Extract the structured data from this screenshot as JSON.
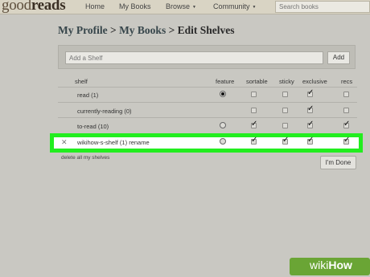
{
  "nav": {
    "logo_light": "good",
    "logo_bold": "reads",
    "home": "Home",
    "my_books": "My Books",
    "browse": "Browse",
    "community": "Community",
    "caret": "▼",
    "search_placeholder": "Search books"
  },
  "breadcrumb": {
    "profile": "My Profile",
    "sep1": ">",
    "books": "My Books",
    "sep2": ">",
    "current": "Edit Shelves"
  },
  "add_shelf": {
    "placeholder": "Add a Shelf",
    "button": "Add"
  },
  "table": {
    "headers": {
      "shelf": "shelf",
      "feature": "feature",
      "sortable": "sortable",
      "sticky": "sticky",
      "exclusive": "exclusive",
      "recs": "recs"
    },
    "rows": [
      {
        "name": "read (1)",
        "feature": true,
        "sortable": false,
        "sticky": false,
        "exclusive": true,
        "recs": false
      },
      {
        "name": "currently-reading (0)",
        "feature": false,
        "sortable": false,
        "sticky": false,
        "exclusive": true,
        "recs": false
      },
      {
        "name": "to-read (10)",
        "feature": false,
        "sortable": true,
        "sticky": false,
        "exclusive": true,
        "recs": true
      },
      {
        "name": "wikihow-s-shelf (1)",
        "rename": "rename",
        "delete": "✕",
        "feature": false,
        "sortable": true,
        "sticky": true,
        "exclusive": true,
        "recs": true
      }
    ]
  },
  "delete_all": "delete all my shelves",
  "done_button": "I'm Done",
  "highlight_color": "#22ee1f",
  "watermark": {
    "wiki": "wiki",
    "how": "How"
  }
}
